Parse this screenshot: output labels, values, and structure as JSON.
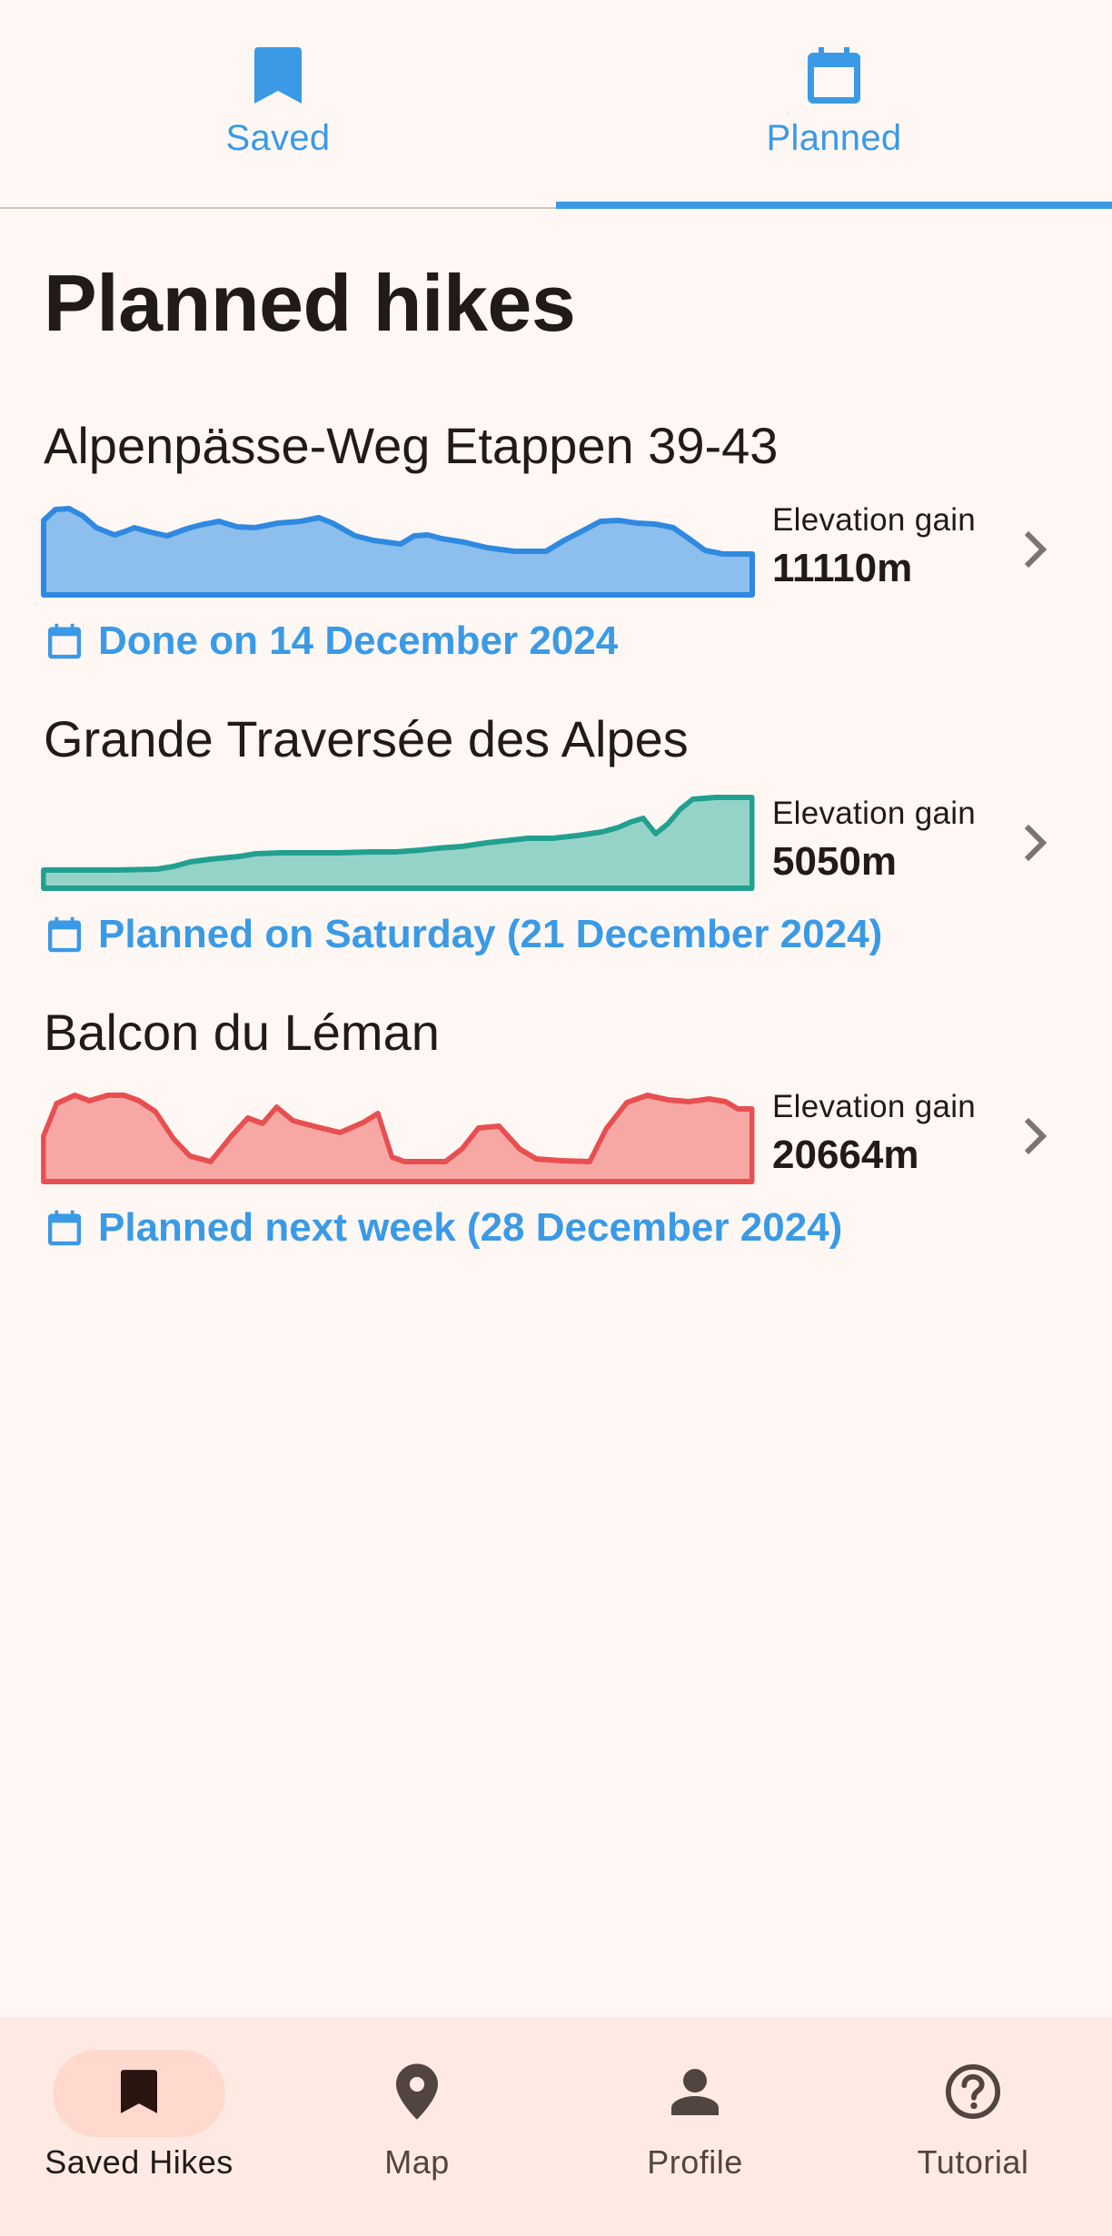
{
  "top_tabs": [
    {
      "label": "Saved",
      "icon": "bookmark-icon",
      "active": false
    },
    {
      "label": "Planned",
      "icon": "calendar-icon",
      "active": true
    }
  ],
  "page_title": "Planned hikes",
  "hikes": [
    {
      "name": "Alpenpässe-Weg Etappen 39-43",
      "elevation_label": "Elevation gain",
      "elevation_value": "11110m",
      "date_text": "Done on 14 December 2024",
      "color": "#2F89E0",
      "fill": "#8CBEEE"
    },
    {
      "name": "Grande Traversée des Alpes",
      "elevation_label": "Elevation gain",
      "elevation_value": "5050m",
      "date_text": "Planned on Saturday (21 December 2024)",
      "color": "#22A08F",
      "fill": "#95D3C8"
    },
    {
      "name": "Balcon du Léman",
      "elevation_label": "Elevation gain",
      "elevation_value": "20664m",
      "date_text": "Planned next week (28 December 2024)",
      "color": "#E84F51",
      "fill": "#F8A8A4"
    }
  ],
  "bottom_nav": [
    {
      "label": "Saved Hikes",
      "icon": "bookmark-icon",
      "active": true
    },
    {
      "label": "Map",
      "icon": "map-pin-icon",
      "active": false
    },
    {
      "label": "Profile",
      "icon": "person-icon",
      "active": false
    },
    {
      "label": "Tutorial",
      "icon": "help-circle-icon",
      "active": false
    }
  ],
  "colors": {
    "accent": "#3A9AE6",
    "background": "#FFF7F4",
    "nav_background": "#FFEAE3",
    "nav_active_pill": "#FFD9CD"
  }
}
